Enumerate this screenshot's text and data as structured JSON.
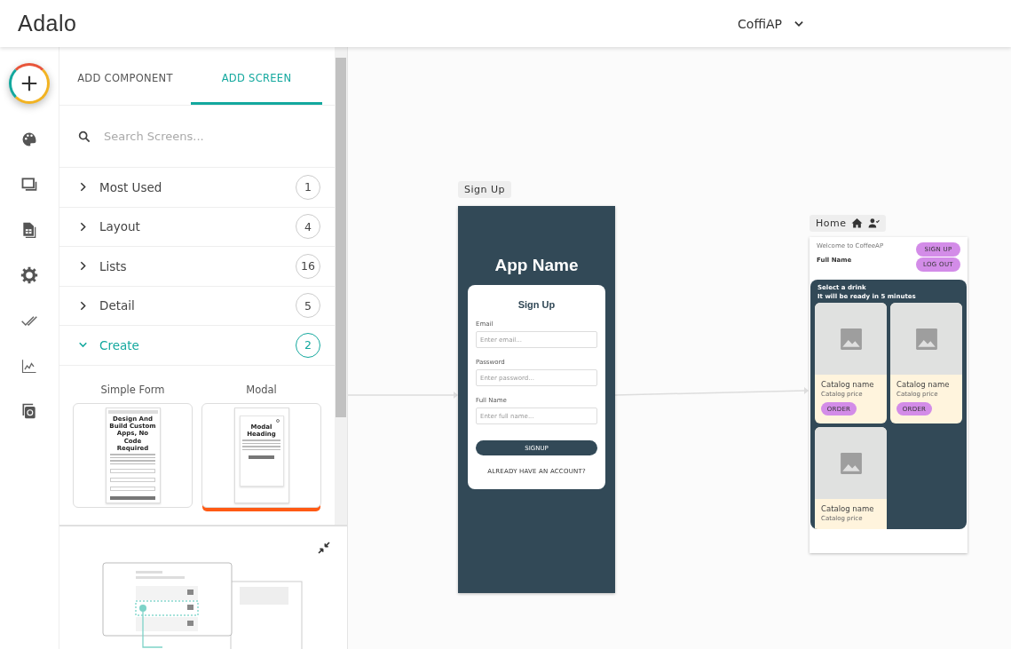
{
  "header": {
    "logo": "Adalo",
    "app_name": "CoffiAP"
  },
  "panel": {
    "tabs": [
      {
        "label": "ADD COMPONENT",
        "selected": false
      },
      {
        "label": "ADD SCREEN",
        "selected": true
      }
    ],
    "search": {
      "placeholder": "Search Screens..."
    },
    "categories": [
      {
        "label": "Most Used",
        "count": "1",
        "expanded": false
      },
      {
        "label": "Layout",
        "count": "4",
        "expanded": false
      },
      {
        "label": "Lists",
        "count": "16",
        "expanded": false
      },
      {
        "label": "Detail",
        "count": "5",
        "expanded": false
      },
      {
        "label": "Create",
        "count": "2",
        "expanded": true
      }
    ],
    "templates": [
      {
        "name": "Simple Form",
        "kind": "form",
        "heading": "Design And Build Custom Apps, No Code Required",
        "selected": false
      },
      {
        "name": "Modal",
        "kind": "modal",
        "heading": "Modal Heading",
        "selected": true
      }
    ]
  },
  "canvas": {
    "signup_screen": {
      "label": "Sign Up",
      "app_name": "App Name",
      "card_title": "Sign Up",
      "fields": [
        {
          "label": "Email",
          "placeholder": "Enter email..."
        },
        {
          "label": "Password",
          "placeholder": "Enter password..."
        },
        {
          "label": "Full Name",
          "placeholder": "Enter full name..."
        }
      ],
      "button": "SIGNUP",
      "link": "ALREADY HAVE AN ACCOUNT?"
    },
    "home_screen": {
      "label": "Home",
      "welcome": "Welcome to CoffeeAP",
      "user_name": "Full Name",
      "buttons": [
        "SIGN UP",
        "LOG OUT"
      ],
      "title": "Select a drink",
      "subtitle": "It will be ready in 5 minutes",
      "cards": [
        {
          "name": "Catalog name",
          "price": "Catalog price",
          "button": "ORDER"
        },
        {
          "name": "Catalog name",
          "price": "Catalog price",
          "button": "ORDER"
        },
        {
          "name": "Catalog name",
          "price": "Catalog price"
        }
      ]
    }
  }
}
